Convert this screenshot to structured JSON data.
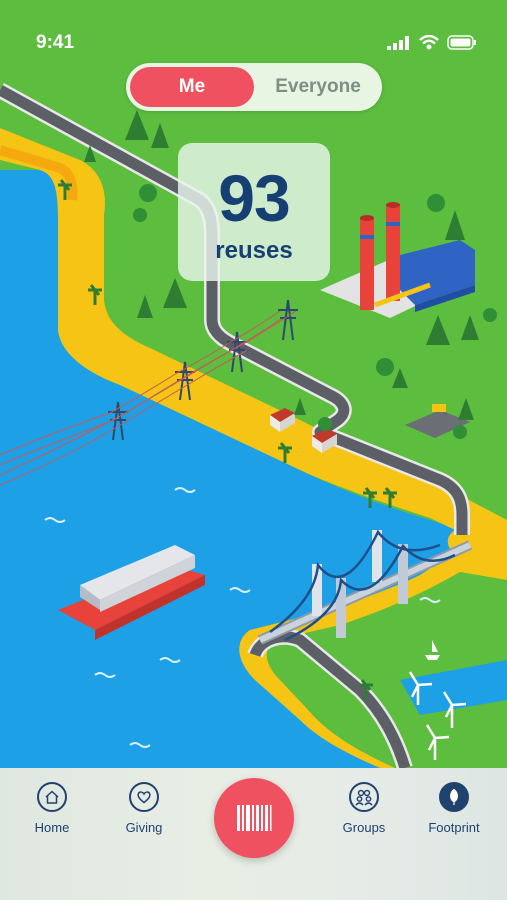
{
  "status_bar": {
    "time": "9:41"
  },
  "scope_toggle": {
    "me_label": "Me",
    "everyone_label": "Everyone",
    "selected": "Me"
  },
  "stats": {
    "count": "93",
    "label": "reuses"
  },
  "tab_bar": {
    "items": [
      {
        "label": "Home",
        "icon": "home-icon"
      },
      {
        "label": "Giving",
        "icon": "heart-icon"
      },
      {
        "label": "Groups",
        "icon": "groups-icon"
      },
      {
        "label": "Footprint",
        "icon": "leaf-icon",
        "active": true
      }
    ],
    "scan_button_icon": "barcode-icon"
  },
  "colors": {
    "accent": "#ef5160",
    "navy": "#163f74",
    "grass": "#5cbd3f",
    "water": "#1ea0e6",
    "sand": "#f5c414"
  }
}
